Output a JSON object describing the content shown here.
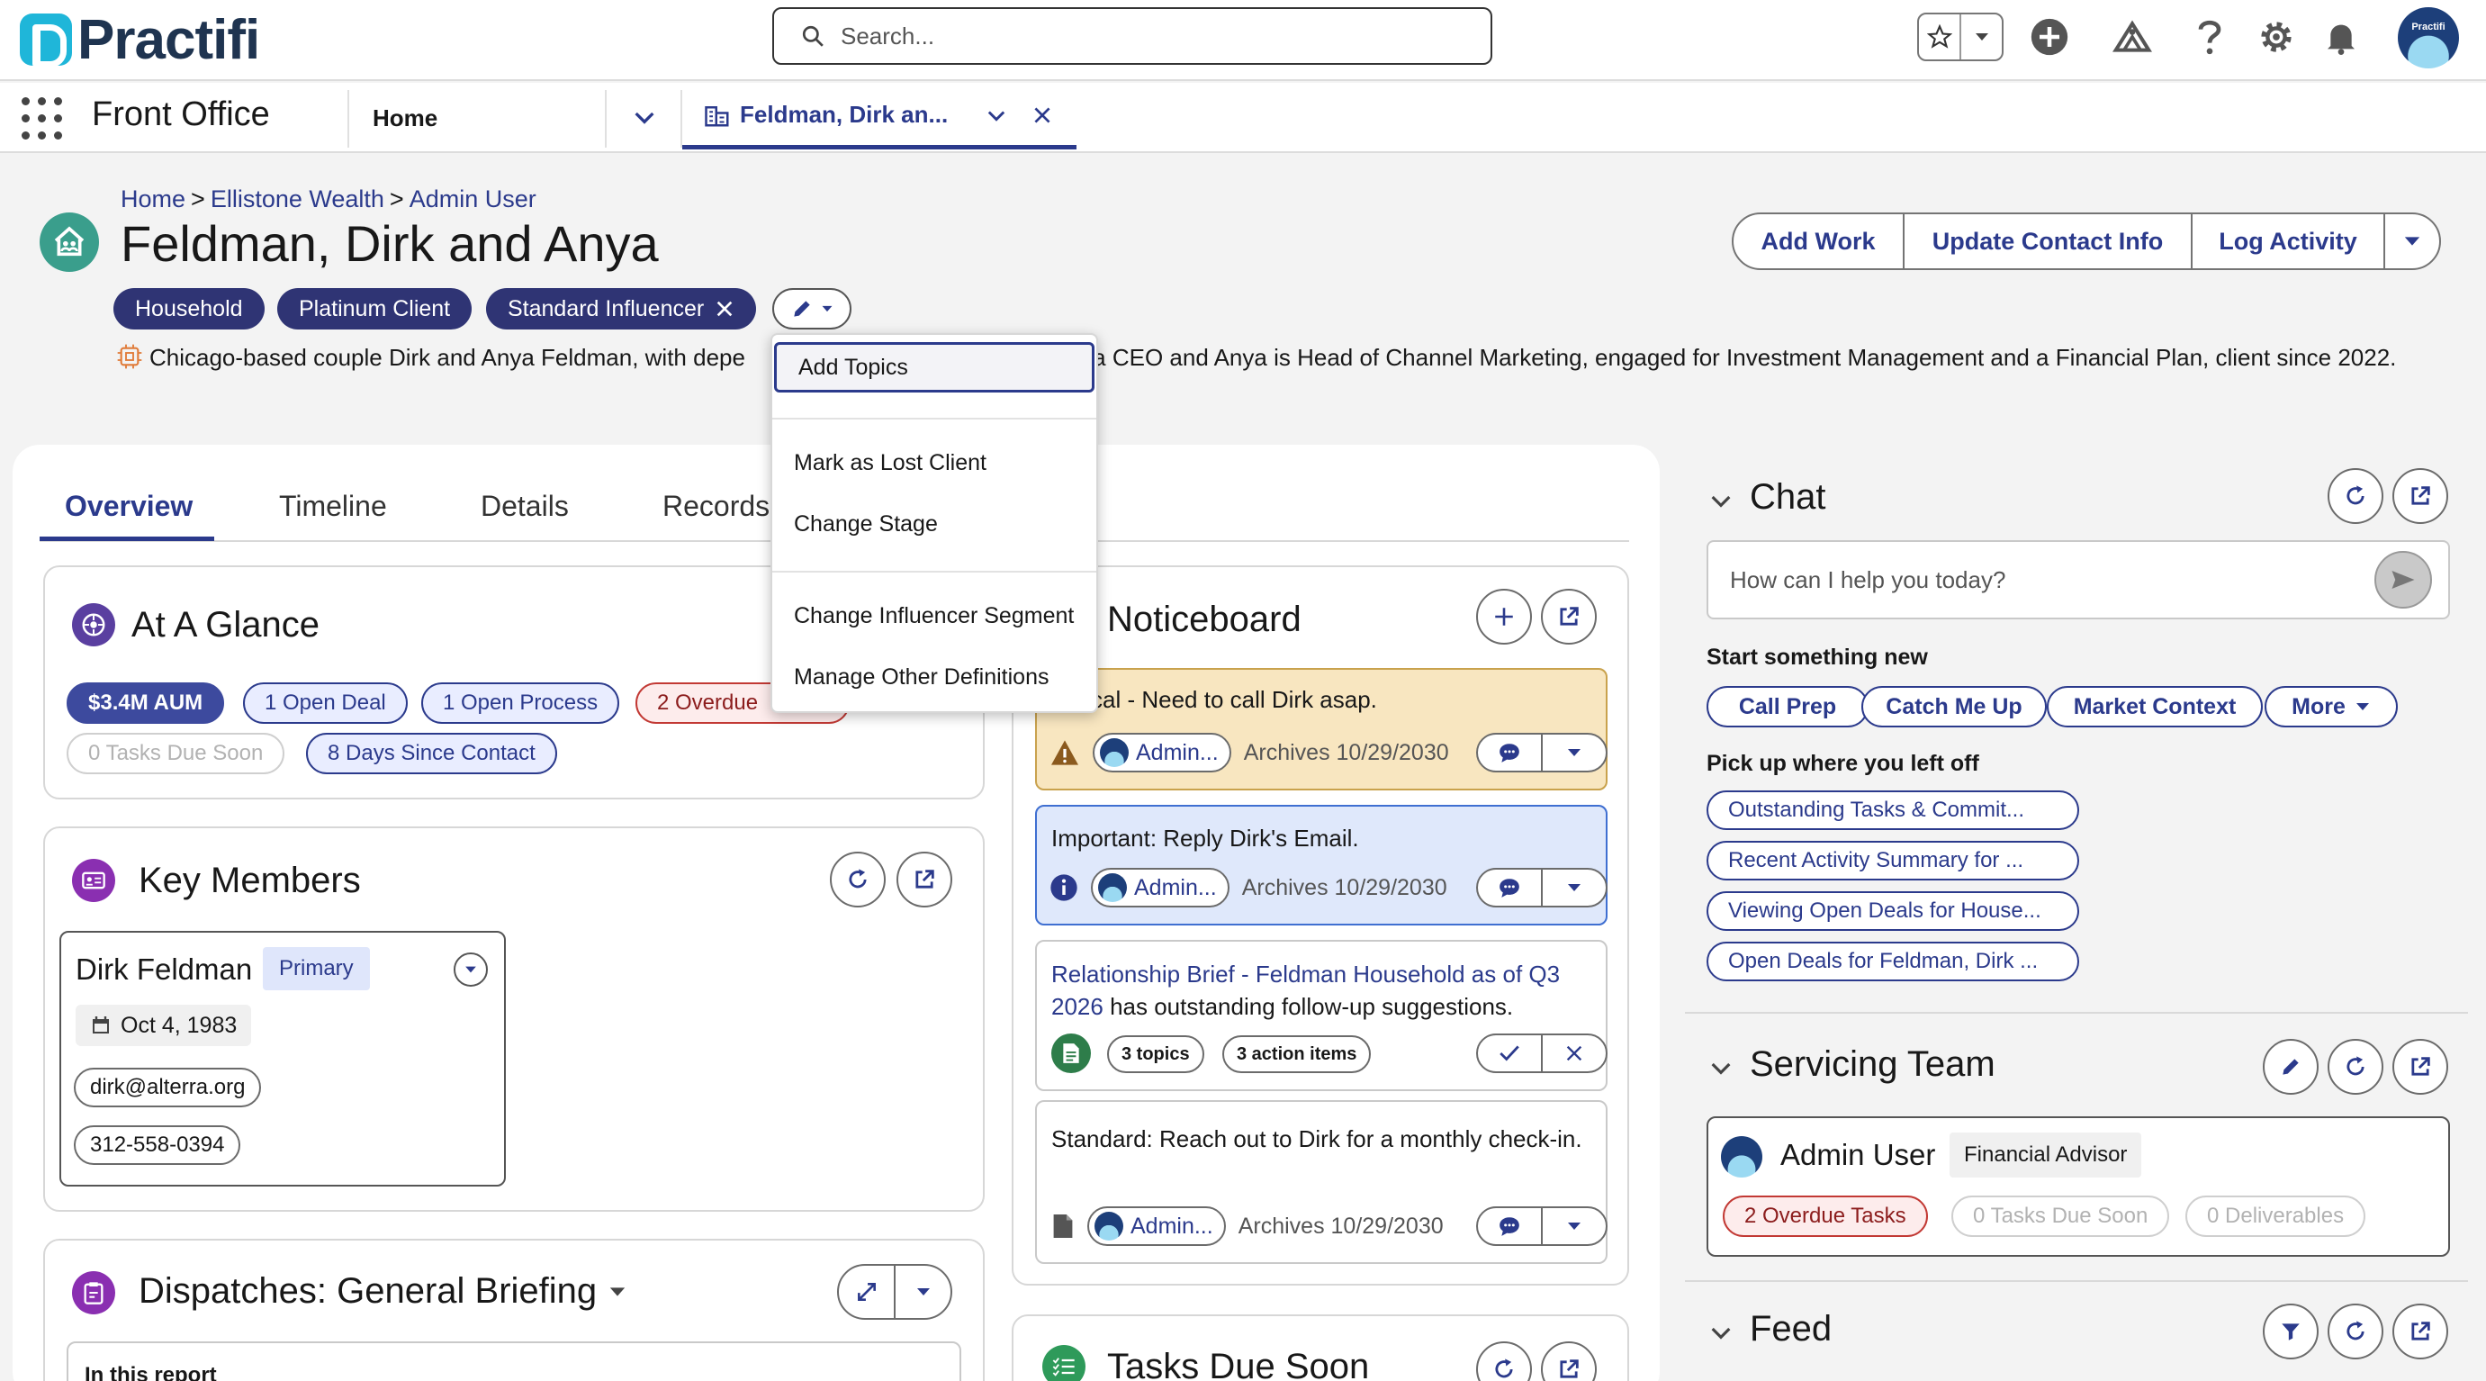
{
  "header": {
    "brand": "Practifi",
    "search_placeholder": "Search...",
    "avatar_text": "Practifi"
  },
  "nav": {
    "app_name": "Front Office",
    "home_tab": "Home",
    "record_tab": "Feldman, Dirk an..."
  },
  "record": {
    "breadcrumb": [
      "Home",
      "Ellistone Wealth",
      "Admin User"
    ],
    "breadcrumb_sep": ">",
    "title": "Feldman, Dirk and Anya",
    "actions": [
      "Add Work",
      "Update Contact Info",
      "Log Activity"
    ],
    "topics": [
      "Household",
      "Platinum Client",
      "Standard Influencer"
    ],
    "summary_start": "Chicago-based couple Dirk and Anya Feldman, with depe",
    "summary_end": "s a CEO and Anya is Head of Channel Marketing, engaged for Investment Management and a Financial Plan, client since 2022."
  },
  "menu": {
    "items": [
      "Add Topics",
      "Mark as Lost Client",
      "Change Stage",
      "Change Influencer Segment",
      "Manage Other Definitions"
    ]
  },
  "tabs": [
    "Overview",
    "Timeline",
    "Details",
    "Records"
  ],
  "glance": {
    "title": "At A Glance",
    "pills": [
      "$3.4M AUM",
      "1 Open Deal",
      "1 Open Process",
      "2 Overdue",
      "0 Tasks Due Soon",
      "8 Days Since Contact"
    ]
  },
  "key_members": {
    "title": "Key Members",
    "member": {
      "name": "Dirk Feldman",
      "badge": "Primary",
      "dob": "Oct 4, 1983",
      "email": "dirk@alterra.org",
      "phone": "312-558-0394"
    }
  },
  "dispatches": {
    "title": "Dispatches: General Briefing",
    "report_label": "In this report"
  },
  "noticeboard": {
    "title": "Noticeboard",
    "items": [
      {
        "text": "cal - Need to call Dirk asap.",
        "owner": "Admin...",
        "archive": "Archives 10/29/2030"
      },
      {
        "text": "Important: Reply Dirk's Email.",
        "owner": "Admin...",
        "archive": "Archives 10/29/2030"
      },
      {
        "link": "Relationship Brief - Feldman Household as of Q3 2026",
        "text": " has outstanding follow-up suggestions.",
        "topics": "3 topics",
        "actions": "3 action items"
      },
      {
        "text": "Standard: Reach out to Dirk for a monthly check-in.",
        "owner": "Admin...",
        "archive": "Archives 10/29/2030"
      }
    ]
  },
  "tasks_due": {
    "title": "Tasks Due Soon"
  },
  "chat": {
    "title": "Chat",
    "placeholder": "How can I help you today?",
    "start_label": "Start something new",
    "starters": [
      "Call Prep",
      "Catch Me Up",
      "Market Context",
      "More"
    ],
    "resume_label": "Pick up where you left off",
    "conversations": [
      "Outstanding Tasks & Commit...",
      "Recent Activity Summary for ...",
      "Viewing Open Deals for House...",
      "Open Deals for Feldman, Dirk ..."
    ]
  },
  "servicing_team": {
    "title": "Servicing Team",
    "member": {
      "name": "Admin User",
      "role": "Financial Advisor"
    },
    "pills": [
      "2 Overdue Tasks",
      "0 Tasks Due Soon",
      "0 Deliverables"
    ]
  },
  "feed": {
    "title": "Feed"
  },
  "colors": {
    "primary": "#2b3a8c",
    "topic_bg": "#2f3474",
    "warning_bg": "#f8e6c0",
    "info_bg": "#dfe8fb",
    "record_icon": "#3a9e8c"
  }
}
